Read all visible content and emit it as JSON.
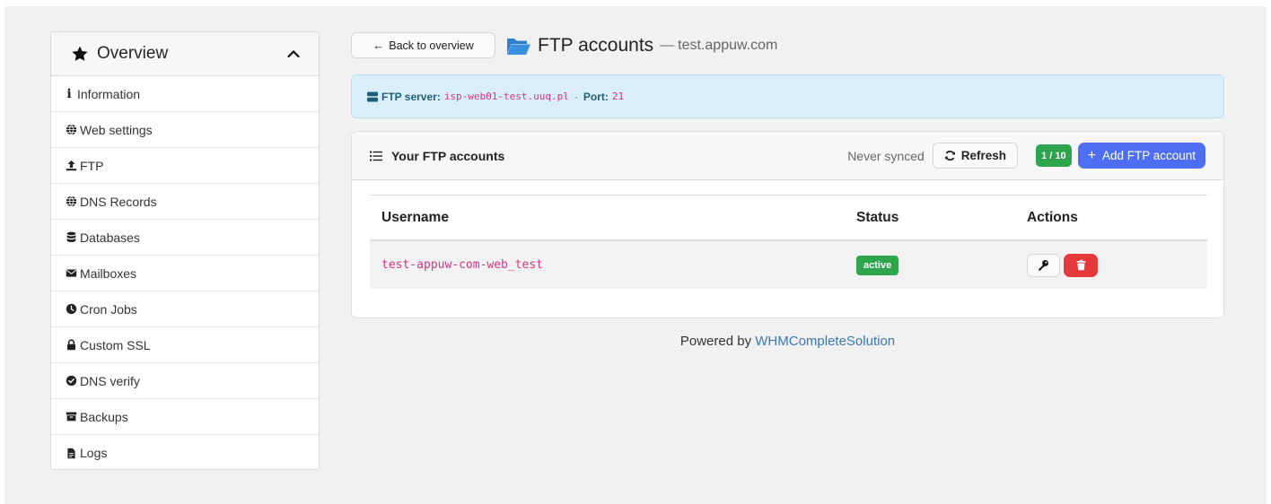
{
  "sidebar": {
    "title": "Overview",
    "items": [
      {
        "label": "Information",
        "icon": "info-icon"
      },
      {
        "label": "Web settings",
        "icon": "globe-icon"
      },
      {
        "label": "FTP",
        "icon": "upload-icon"
      },
      {
        "label": "DNS Records",
        "icon": "globe-icon"
      },
      {
        "label": "Databases",
        "icon": "database-icon"
      },
      {
        "label": "Mailboxes",
        "icon": "envelope-icon"
      },
      {
        "label": "Cron Jobs",
        "icon": "clock-icon"
      },
      {
        "label": "Custom SSL",
        "icon": "lock-icon"
      },
      {
        "label": "DNS verify",
        "icon": "check-circle-icon"
      },
      {
        "label": "Backups",
        "icon": "archive-icon"
      },
      {
        "label": "Logs",
        "icon": "file-icon"
      }
    ]
  },
  "header": {
    "back_label": "Back to overview",
    "title": "FTP accounts",
    "dash": "—",
    "domain": "test.appuw.com"
  },
  "alert": {
    "server_label": "FTP server:",
    "server_value": "isp-web01-test.uuq.pl",
    "separator": "·",
    "port_label": "Port:",
    "port_value": "21"
  },
  "card": {
    "title": "Your FTP accounts",
    "sync_status": "Never synced",
    "refresh_label": "Refresh",
    "count": "1 / 10",
    "add_label": "Add FTP account"
  },
  "table": {
    "headers": {
      "username": "Username",
      "status": "Status",
      "actions": "Actions"
    },
    "rows": [
      {
        "username": "test-appuw-com-web_test",
        "status": "active"
      }
    ]
  },
  "footer": {
    "prefix": "Powered by",
    "link": "WHMCompleteSolution"
  },
  "colors": {
    "accent": "#4d6ef2",
    "success": "#2ea44f",
    "danger": "#e5383b",
    "code": "#d63384",
    "link": "#3a77b5"
  }
}
